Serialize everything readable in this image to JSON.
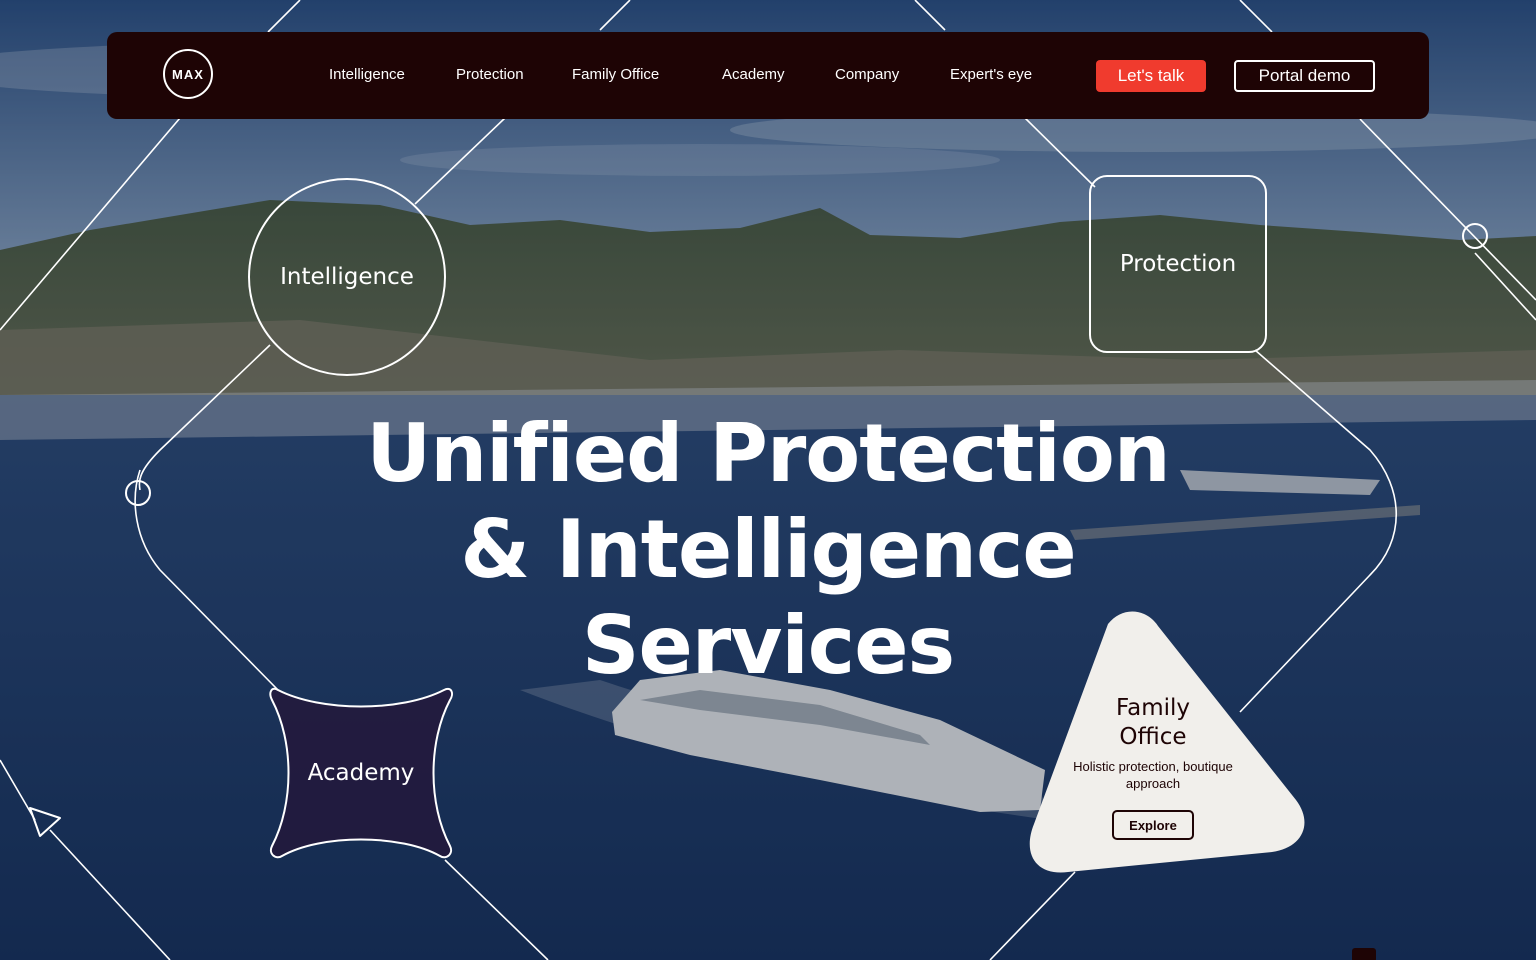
{
  "nav": {
    "logo_text": "MAX",
    "links": [
      "Intelligence",
      "Protection",
      "Family Office",
      "Academy",
      "Company",
      "Expert's eye"
    ],
    "cta_primary": "Let's talk",
    "cta_secondary": "Portal demo"
  },
  "hero": {
    "title_lines": [
      "Unified Protection",
      "& Intelligence",
      "Services"
    ]
  },
  "nodes": {
    "intelligence": "Intelligence",
    "protection": "Protection",
    "academy": "Academy",
    "family_office": {
      "title_lines": [
        "Family",
        "Office"
      ],
      "description": "Holistic protection, boutique approach",
      "button": "Explore"
    }
  },
  "colors": {
    "nav_bg": "#1e0405",
    "accent": "#f03b2e",
    "card_bg": "#f1efeb",
    "academy_fill": "#24163a"
  },
  "icons": [
    "max-logo",
    "triangle-marker-icon",
    "circle-node-icon"
  ]
}
